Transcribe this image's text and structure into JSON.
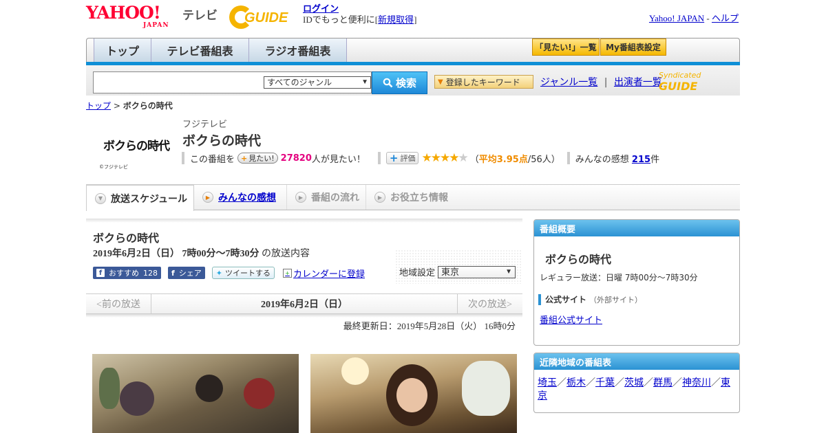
{
  "header": {
    "yahoo_logo_main": "YAHOO!",
    "yahoo_logo_sub": "JAPAN",
    "tv_label": "テレビ",
    "gguide_logo": "GUIDE",
    "login_label": "ログイン",
    "login_text": "IDでもっと便利に[",
    "register_label": "新規取得",
    "register_close": "]",
    "yahoo_japan_link": "Yahoo! JAPAN",
    "link_separator": " - ",
    "help_link": "ヘルプ"
  },
  "nav": {
    "tabs": [
      {
        "label": "トップ"
      },
      {
        "label": "テレビ番組表"
      },
      {
        "label": "ラジオ番組表"
      }
    ],
    "mitai_list_label": "「見たい!」一覧",
    "my_schedule_label": "My番組表設定"
  },
  "search": {
    "genre_selected": "すべてのジャンル",
    "button_label": "検索",
    "keyword_button": "登録したキーワード",
    "genre_list_link": "ジャンル一覧",
    "link_sep": "|",
    "performer_list_link": "出演者一覧",
    "syndicated_label": "Syndicated",
    "syndicated_logo": "GUIDE"
  },
  "breadcrumb": {
    "top_link": "トップ",
    "separator": " > ",
    "current": "ボクらの時代"
  },
  "program": {
    "logo_text": "ボクらの時代",
    "logo_copyright": "©フジテレビ",
    "station": "フジテレビ",
    "title": "ボクらの時代",
    "mitai_prefix": "この番組を",
    "mitai_button": "見たい!",
    "mitai_count": "27820",
    "mitai_suffix": "人が見たい！",
    "hyoka_button": "評価",
    "rating": 3.95,
    "rating_open": "（",
    "avg_label": "平均3.95点",
    "avg_votes": "/56人）",
    "kansou_label": "みんなの感想",
    "kansou_count": "215",
    "kansou_suffix": "件"
  },
  "sub_tabs": [
    {
      "label": "放送スケジュール"
    },
    {
      "label": "みんなの感想"
    },
    {
      "label": "番組の流れ"
    },
    {
      "label": "お役立ち情報"
    }
  ],
  "schedule": {
    "title": "ボクらの時代",
    "date_time": "2019年6月2日（日） 7時00分～7時30分",
    "date_suffix": " の放送内容",
    "fb_recommend": "おすすめ",
    "fb_count": "128",
    "fb_share": "シェア",
    "tweet": "ツイートする",
    "calendar": "カレンダーに登録",
    "region_label": "地域設定",
    "region_value": "東京",
    "prev": "<前の放送",
    "current_date": "2019年6月2日（日）",
    "next": "次の放送>",
    "updated": "最終更新日：2019年5月28日（火） 16時0分"
  },
  "overview": {
    "head": "番組概要",
    "title": "ボクらの時代",
    "air": "レギュラー放送：日曜 7時00分～7時30分",
    "official_head": "公式サイト",
    "official_sub": "（外部サイト）",
    "official_link": "番組公式サイト"
  },
  "nearby": {
    "head": "近隣地域の番組表",
    "regions": [
      "埼玉",
      "栃木",
      "千葉",
      "茨城",
      "群馬",
      "神奈川",
      "東京"
    ],
    "separator": "／"
  },
  "colors": {
    "accent_blue": "#0f8fd6",
    "gold": "#f5b400",
    "pink_count": "#e4007f",
    "link": "#0000cc"
  }
}
